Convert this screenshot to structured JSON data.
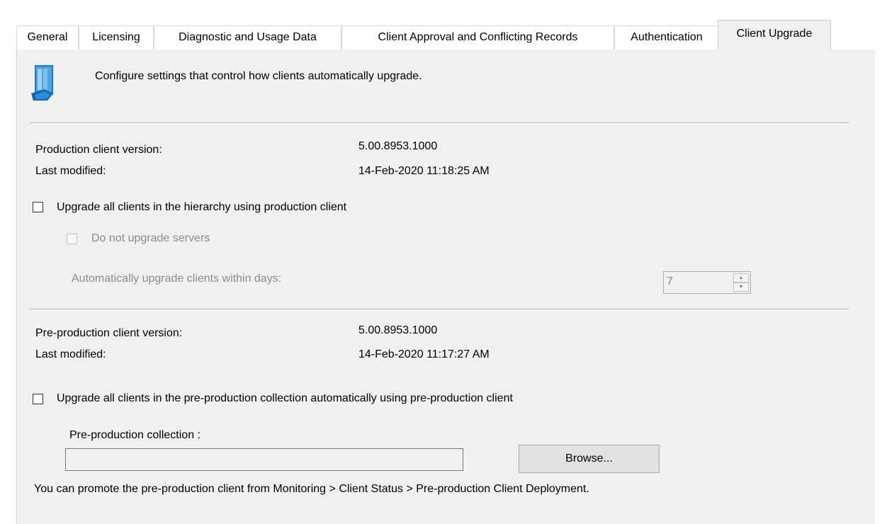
{
  "tabs": [
    {
      "label": "General",
      "active": false
    },
    {
      "label": "Licensing",
      "active": false
    },
    {
      "label": "Diagnostic and Usage Data",
      "active": false
    },
    {
      "label": "Client Approval and Conflicting Records",
      "active": false
    },
    {
      "label": "Authentication",
      "active": false
    },
    {
      "label": "Client Upgrade",
      "active": true
    }
  ],
  "header": {
    "icon": "client-upgrade-icon",
    "description": "Configure settings that control how clients automatically upgrade."
  },
  "production": {
    "version_label": "Production client version:",
    "version_value": "5.00.8953.1000",
    "modified_label": "Last modified:",
    "modified_value": "14-Feb-2020 11:18:25 AM",
    "upgrade_checkbox_label": "Upgrade all clients in the hierarchy using production client",
    "upgrade_checked": false,
    "servers_checkbox_label": "Do not upgrade servers",
    "servers_checked": false,
    "days_label": "Automatically upgrade clients within days:",
    "days_value": "7"
  },
  "preproduction": {
    "version_label": "Pre-production client version:",
    "version_value": "5.00.8953.1000",
    "modified_label": "Last modified:",
    "modified_value": "14-Feb-2020 11:17:27 AM",
    "upgrade_checkbox_label": "Upgrade all clients in the pre-production collection automatically using pre-production client",
    "upgrade_checked": false,
    "collection_label": "Pre-production collection :",
    "collection_value": "",
    "browse_label": "Browse...",
    "note": "You can promote the pre-production client from Monitoring > Client Status > Pre-production Client Deployment."
  },
  "colors": {
    "panel_bg": "#f0f0f0",
    "disabled_text": "#8c8c8c",
    "icon_blue": "#1e78c8"
  }
}
